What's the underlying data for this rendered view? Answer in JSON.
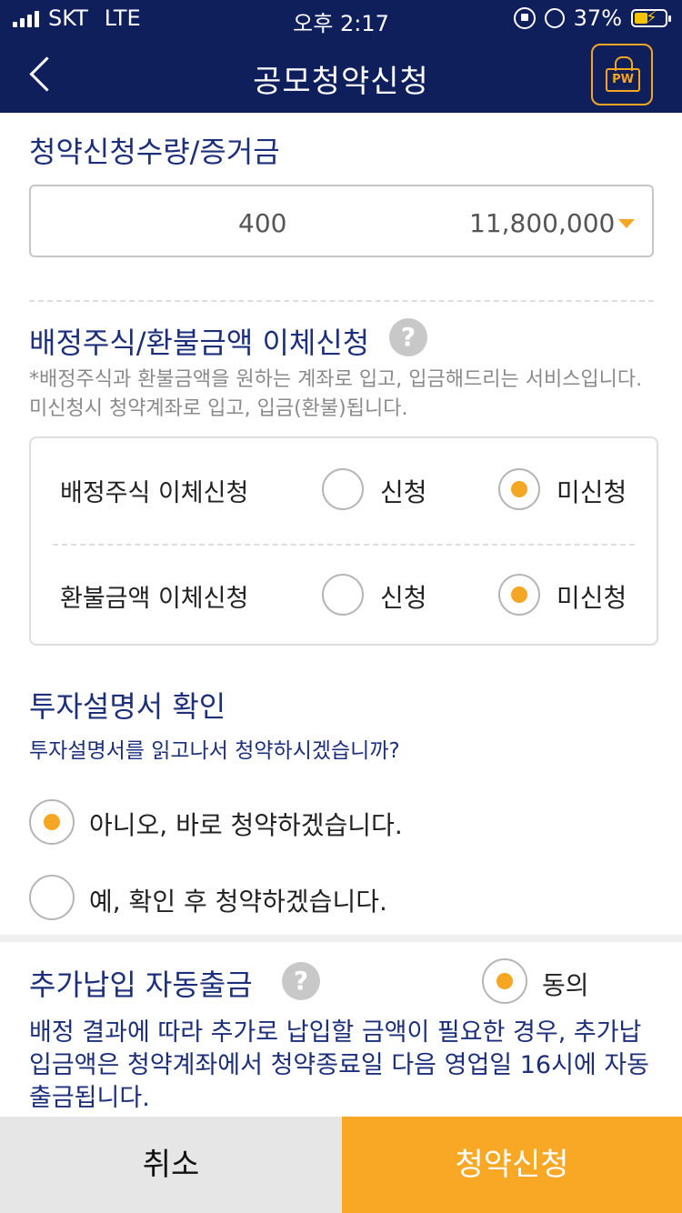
{
  "status": {
    "carrier": "SKT",
    "network": "LTE",
    "time": "오후 2:17",
    "battery": "37%"
  },
  "nav": {
    "title": "공모청약신청",
    "pw_label": "PW"
  },
  "subscription": {
    "title": "청약신청수량/증거금",
    "quantity": "400",
    "amount": "11,800,000"
  },
  "transfer": {
    "title": "배정주식/환불금액 이체신청",
    "help": "?",
    "note": "*배정주식과 환불금액을 원하는 계좌로 입고, 입금해드리는 서비스입니다. 미신청시 청약계좌로 입고, 입금(환불)됩니다.",
    "rows": [
      {
        "label": "배정주식 이체신청",
        "apply": "신청",
        "not_apply": "미신청",
        "selected": "not_apply"
      },
      {
        "label": "환불금액 이체신청",
        "apply": "신청",
        "not_apply": "미신청",
        "selected": "not_apply"
      }
    ]
  },
  "prospectus": {
    "title": "투자설명서 확인",
    "question": "투자설명서를 읽고나서 청약하시겠습니까?",
    "options": [
      "아니오, 바로 청약하겠습니다.",
      "예, 확인 후 청약하겠습니다."
    ],
    "selected_index": 0
  },
  "auto_withdraw": {
    "title": "추가납입 자동출금",
    "help": "?",
    "agree_label": "동의",
    "agreed": true,
    "desc": "배정 결과에 따라 추가로 납입할 금액이 필요한 경우, 추가납입금액은 청약계좌에서 청약종료일 다음 영업일 16시에 자동 출금됩니다."
  },
  "buttons": {
    "cancel": "취소",
    "submit": "청약신청"
  },
  "colors": {
    "navy": "#0f1f5c",
    "accent": "#f5a623",
    "title_blue": "#1d2f7a"
  }
}
